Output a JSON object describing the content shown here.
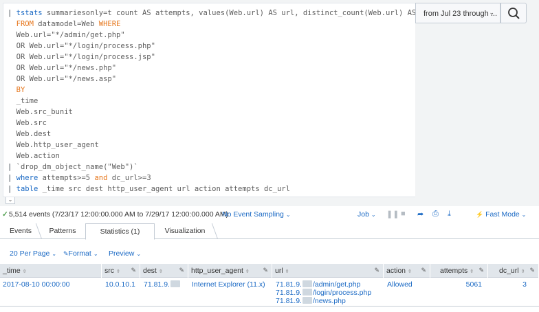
{
  "search": {
    "query_lines": [
      {
        "pipe": "| ",
        "cmd": "tstats",
        "rest": " summariesonly=t count AS attempts, values(Web.url) AS url, distinct_count(Web.url) AS dc_url",
        "indent": ""
      },
      {
        "kw": "FROM",
        "rest": " datamodel=Web ",
        "kw2": "WHERE",
        "indent": "  "
      },
      {
        "rest": "Web.url=\"*/admin/get.php\"",
        "indent": "  "
      },
      {
        "rest": "OR Web.url=\"*/login/process.php\"",
        "indent": "  "
      },
      {
        "rest": "OR Web.url=\"*/login/process.jsp\"",
        "indent": "  "
      },
      {
        "rest": "OR Web.url=\"*/news.php\"",
        "indent": "  "
      },
      {
        "rest": "OR Web.url=\"*/news.asp\"",
        "indent": "  "
      },
      {
        "kw": "BY",
        "indent": "  "
      },
      {
        "rest": "_time",
        "indent": "  "
      },
      {
        "rest": "Web.src_bunit",
        "indent": "  "
      },
      {
        "rest": "Web.src",
        "indent": "  "
      },
      {
        "rest": "Web.dest",
        "indent": "  "
      },
      {
        "rest": "Web.http_user_agent",
        "indent": "  "
      },
      {
        "rest": "Web.action",
        "indent": "  "
      },
      {
        "pipe": "| ",
        "rest": "`drop_dm_object_name(\"Web\")`",
        "indent": ""
      },
      {
        "pipe": "| ",
        "cmd": "where",
        "rest": " attempts>=5 ",
        "kw": "and",
        "rest2": " dc_url>=3",
        "indent": ""
      },
      {
        "pipe": "| ",
        "cmd": "table",
        "rest": " _time src dest http_user_agent url action attempts dc_url",
        "indent": ""
      }
    ],
    "time_range": "from Jul 23 through ...",
    "search_icon": "search-icon"
  },
  "status": {
    "events_text": "5,514 events (7/23/17 12:00:00.000 AM to 7/29/17 12:00:00.000 AM)",
    "sampling": "No Event Sampling",
    "job": "Job",
    "fast_mode": "Fast Mode"
  },
  "tabs": [
    {
      "label": "Events"
    },
    {
      "label": "Patterns"
    },
    {
      "label": "Statistics (1)"
    },
    {
      "label": "Visualization"
    }
  ],
  "controls": {
    "per_page": "20 Per Page",
    "format": "Format",
    "preview": "Preview"
  },
  "table": {
    "columns": [
      "_time",
      "src",
      "dest",
      "http_user_agent",
      "url",
      "action",
      "attempts",
      "dc_url"
    ],
    "rows": [
      {
        "time": "2017-08-10 00:00:00",
        "src": "10.0.10.1",
        "dest_prefix": "71.81.9.",
        "user_agent": "Internet Explorer (11.x)",
        "url_prefix": "71.81.9.",
        "urls": [
          "/admin/get.php",
          "/login/process.php",
          "/news.php"
        ],
        "action": "Allowed",
        "attempts": "5061",
        "dc_url": "3"
      }
    ]
  },
  "colors": {
    "link": "#1a69c4",
    "keyword": "#e6751a",
    "success": "#53a051",
    "header_bg": "#e1e6eb"
  }
}
